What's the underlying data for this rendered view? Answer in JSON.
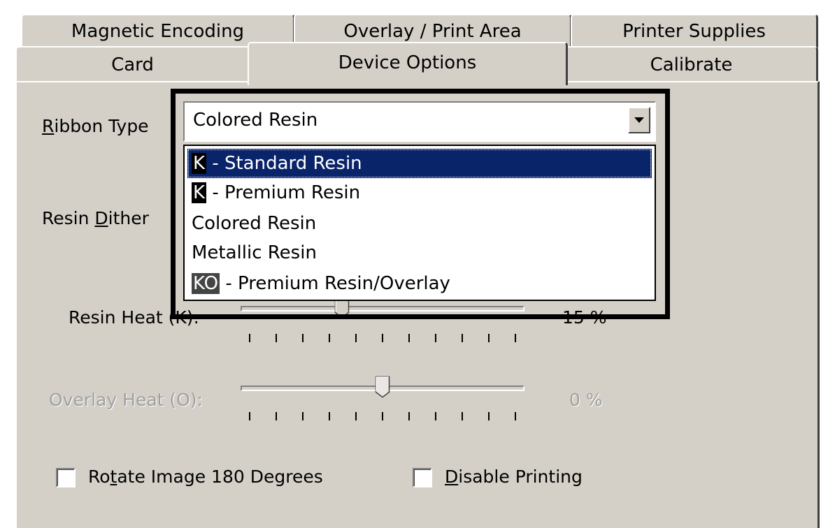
{
  "tabs": {
    "row1": [
      "Magnetic Encoding",
      "Overlay / Print Area",
      "Printer Supplies"
    ],
    "row2": [
      "Card",
      "Device Options",
      "Calibrate"
    ],
    "active": "Device Options"
  },
  "ribbon_type": {
    "label_underline": "R",
    "label_rest": "ibbon Type",
    "selected_value": "Colored Resin",
    "options": [
      {
        "badge": "K",
        "text": " - Standard Resin",
        "selected": true
      },
      {
        "badge": "K",
        "text": " - Premium Resin",
        "selected": false
      },
      {
        "badge": "",
        "text": "Colored Resin",
        "selected": false
      },
      {
        "badge": "",
        "text": "Metallic Resin",
        "selected": false
      },
      {
        "badge": "KO",
        "text": " - Premium Resin/Overlay",
        "selected": false
      }
    ]
  },
  "resin_dither": {
    "label_pre": "Resin ",
    "label_underline": "D",
    "label_post": "ither"
  },
  "resin_heat": {
    "label": "Resin Heat (K):",
    "value_text": "15 %",
    "level_percent": 15
  },
  "overlay_heat": {
    "label": "Overlay Heat (O):",
    "value_text": "0 %",
    "level_percent": 0,
    "enabled": false
  },
  "checkboxes": {
    "rotate": {
      "pre": "Ro",
      "underline": "t",
      "post": "ate Image 180 Degrees",
      "checked": false
    },
    "disable": {
      "pre": "",
      "underline": "D",
      "post": "isable Printing",
      "checked": false
    }
  },
  "colors": {
    "dialog_bg": "#d4d0c8",
    "selection_bg": "#0a246a",
    "disabled_text": "#a0a0a0"
  }
}
